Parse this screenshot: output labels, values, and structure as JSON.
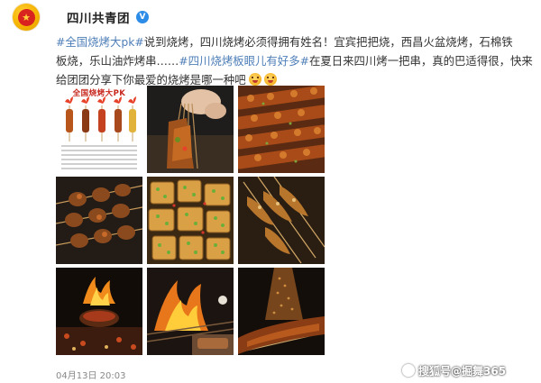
{
  "header": {
    "account_name": "四川共青团",
    "verified_badge": "V",
    "avatar_icon": "communist-youth-league-emblem"
  },
  "post": {
    "hashtag_1": "#全国烧烤大pk#",
    "text_1a": "说到烧烤，四川烧烤必须得拥有姓名！宜宾把把烧，西昌火盆烧烤，石棉铁",
    "text_2a": "板烧，乐山油炸烤串……",
    "hashtag_2": "#四川烧烤板眼儿有好多#",
    "text_2b": "在夏日来四川烤一把串，真的巴适得很，快来",
    "text_3a": "给团团分享下你最爱的烧烤是哪一种吧",
    "emoji_1": "smile-emoji",
    "emoji_2": "smile-emoji"
  },
  "photos": {
    "infographic_title": "全国烧烤大PK"
  },
  "footer": {
    "timestamp": "04月13日 20:03",
    "watermark": "搜狐号@掘舞365"
  },
  "colors": {
    "hashtag": "#4f7fb8",
    "text": "#333333",
    "timestamp": "#888888"
  }
}
